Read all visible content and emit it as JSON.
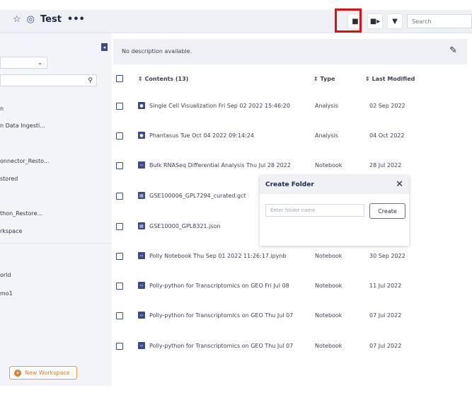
{
  "header": {
    "title": "Test",
    "more_label": "•••",
    "search_placeholder": "Search",
    "icons": [
      "star-icon",
      "eye-icon",
      "new-folder-icon",
      "upload-file-icon",
      "filter-icon"
    ]
  },
  "sidebar": {
    "items": [
      {
        "label": "n"
      },
      {
        "label": "n Data Ingesti..."
      },
      {
        "label": "onnector_Resto..."
      },
      {
        "label": "stored"
      },
      {
        "label": "thon_Restore..."
      },
      {
        "label": "rkspace"
      },
      {
        "label": "orld"
      },
      {
        "label": "mo1"
      }
    ],
    "new_workspace_label": "New Workspace"
  },
  "main": {
    "description": "No description available.",
    "columns": {
      "contents": "Contents (13)",
      "type": "Type",
      "last_modified": "Last Modified"
    },
    "rows": [
      {
        "name": "Single Cell Visualization Fri Sep 02 2022 15:46:20",
        "type": "Analysis",
        "modified": "02 Sep 2022",
        "icon": "analysis"
      },
      {
        "name": "Phantasus Tue Oct 04 2022 09:14:24",
        "type": "Analysis",
        "modified": "04 Oct 2022",
        "icon": "analysis"
      },
      {
        "name": "Bulk RNASeq Differential Analysis Thu Jul 28 2022",
        "type": "Notebook",
        "modified": "28 Jul 2022",
        "icon": "notebook"
      },
      {
        "name": "GSE100006_GPL7294_curated.gct",
        "type": "",
        "modified": "",
        "icon": "file"
      },
      {
        "name": "GSE10000_GPL8321.json",
        "type": "",
        "modified": "",
        "icon": "file"
      },
      {
        "name": "Polly Notebook Thu Sep 01 2022 11:26:17.ipynb",
        "type": "Notebook",
        "modified": "30 Sep 2022",
        "icon": "notebook"
      },
      {
        "name": "Polly-python for Transcriptomics on GEO Fri Jul 08",
        "type": "Notebook",
        "modified": "11 Jul 2022",
        "icon": "notebook"
      },
      {
        "name": "Polly-python for Transcriptomics on GEO Thu Jul 07",
        "type": "Notebook",
        "modified": "07 Jul 2022",
        "icon": "notebook"
      },
      {
        "name": "Polly-python for Transcriptomics on GEO Thu Jul 07",
        "type": "Notebook",
        "modified": "07 Jul 2022",
        "icon": "notebook"
      }
    ]
  },
  "modal": {
    "title": "Create Folder",
    "close_label": "✕",
    "input_placeholder": "Enter folder name",
    "create_label": "Create"
  },
  "colors": {
    "accent": "#3b4a8a",
    "highlight": "#e01010",
    "orange": "#e07b2a"
  }
}
